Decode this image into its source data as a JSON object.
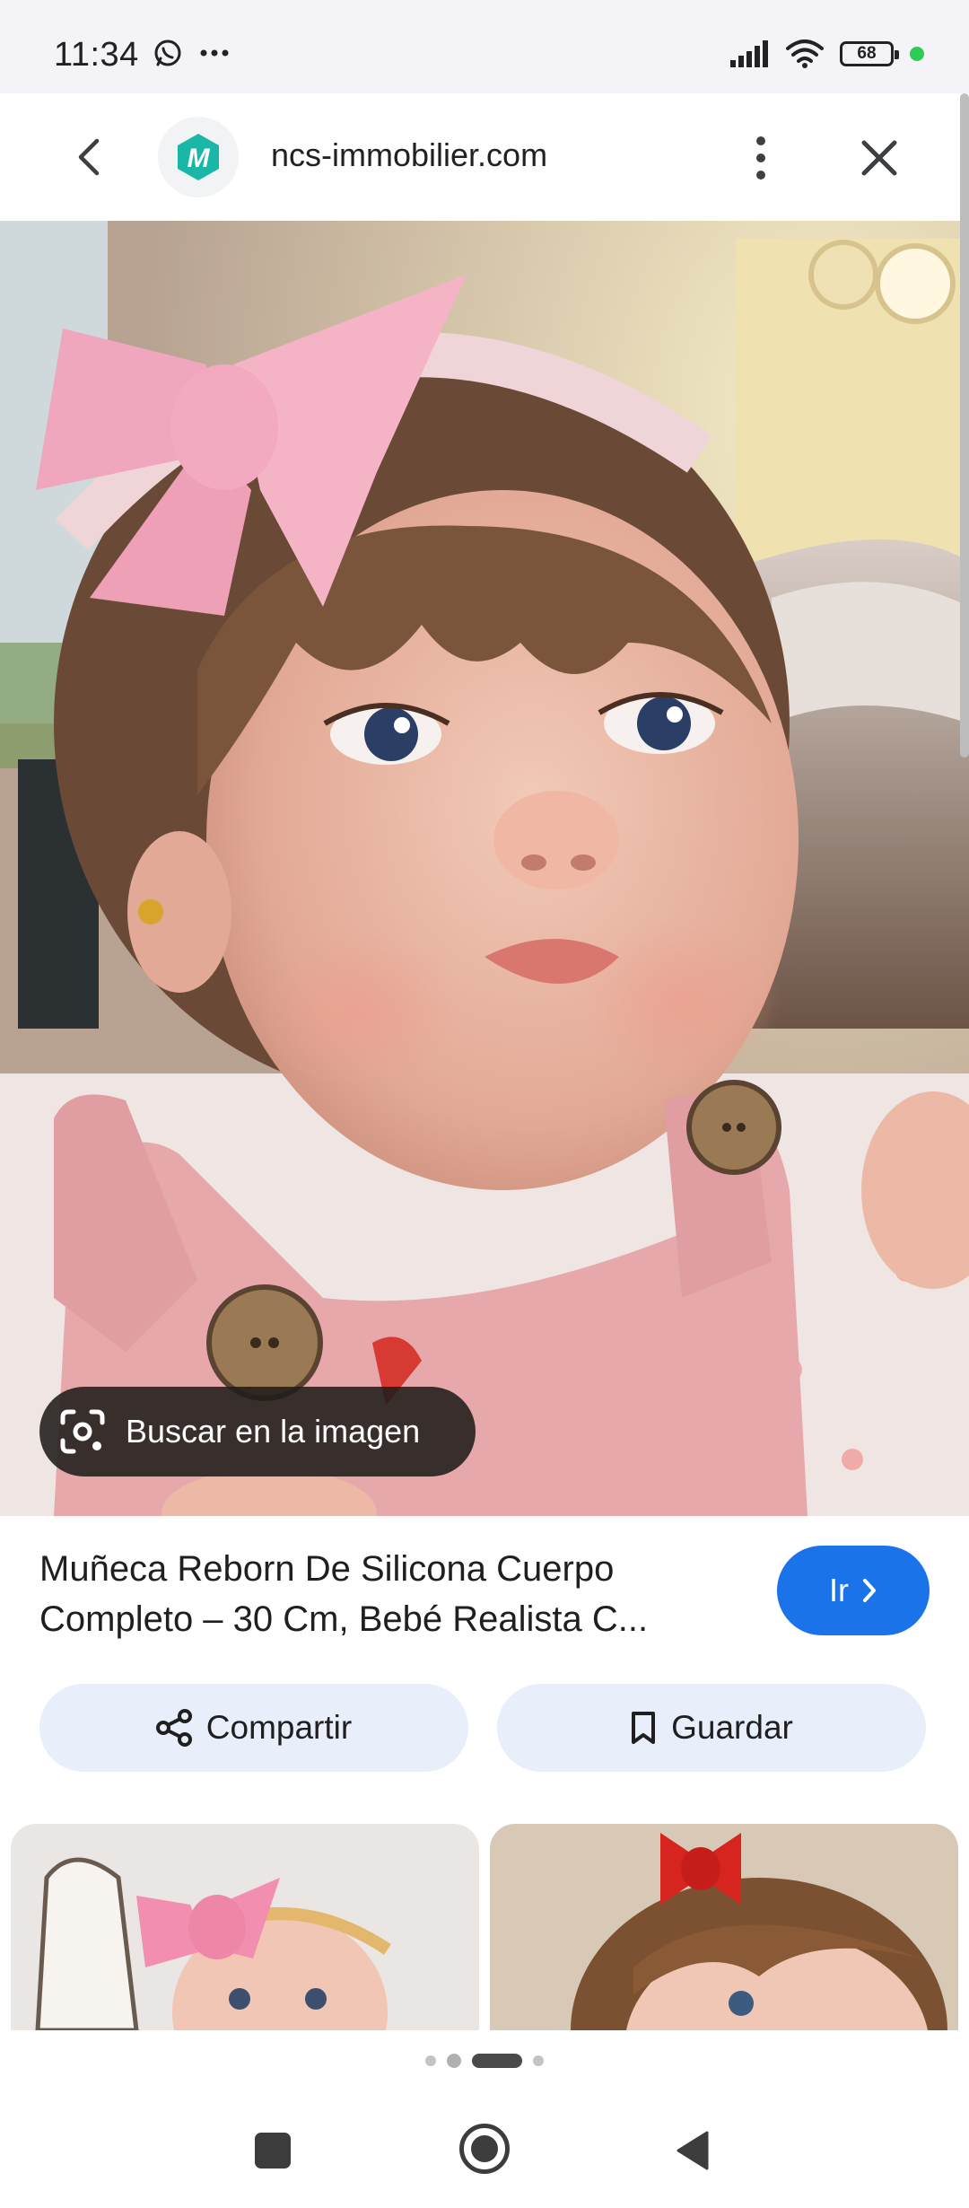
{
  "status_bar": {
    "time": "11:34",
    "battery": "68",
    "icons": [
      "whatsapp-icon",
      "more-notifications-icon",
      "signal-icon",
      "wifi-icon",
      "battery-icon"
    ]
  },
  "header": {
    "site": "ncs-immobilier.com",
    "logo_letter": "M",
    "brand_color": "#1bb7a6"
  },
  "image": {
    "lens_label": "Buscar en la imagen"
  },
  "result": {
    "title": "Muñeca Reborn De Silicona Cuerpo Completo – 30 Cm, Bebé Realista C...",
    "go_label": "Ir"
  },
  "actions": {
    "share_label": "Compartir",
    "save_label": "Guardar"
  },
  "colors": {
    "accent": "#1a73e8",
    "chip_bg": "#e8eefa"
  },
  "pager": {
    "count": 4,
    "active": 3
  }
}
